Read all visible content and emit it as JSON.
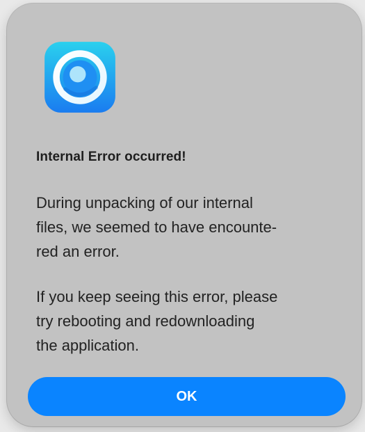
{
  "dialog": {
    "icon": "app-ring-icon",
    "title": "Internal Error occurred!",
    "message_1": "During unpacking of our internal\nfiles, we seemed to have encounte-\nred an error.",
    "message_2": "If you keep seeing this error, please\ntry rebooting and redownloading\nthe application.",
    "ok_label": "OK"
  },
  "colors": {
    "dialog_background": "#c2c2c2",
    "button_accent": "#0a84ff",
    "icon_gradient_top": "#2ad0ee",
    "icon_gradient_bottom": "#1a7cf0"
  }
}
